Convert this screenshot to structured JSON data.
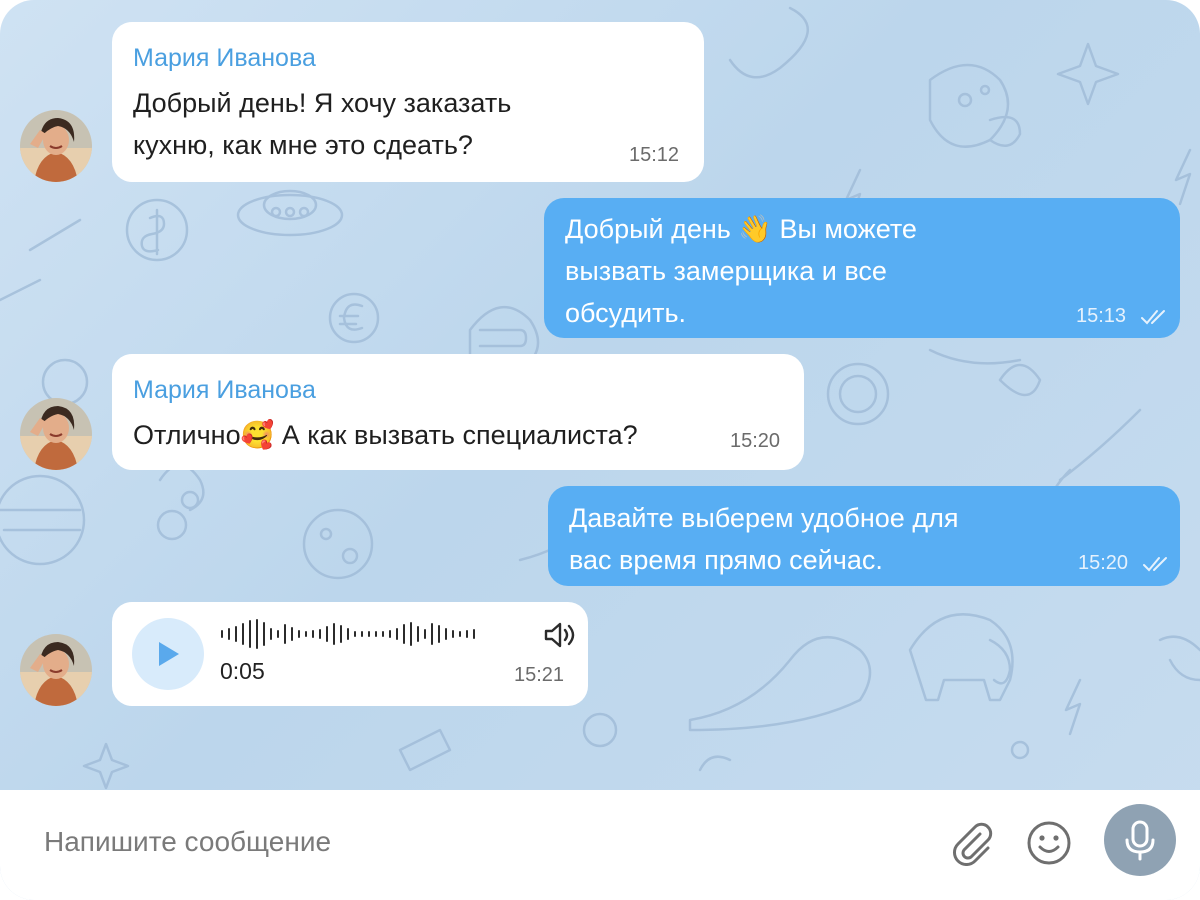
{
  "messages": [
    {
      "sender": "Мария Иванова",
      "text": "Добрый день! Я хочу заказать\nкухню, как мне это сдеать?",
      "time": "15:12"
    },
    {
      "text": "Добрый день 👋 Вы можете\nвызвать замерщика и все\nобсудить.",
      "time": "15:13",
      "status": "read-double-check"
    },
    {
      "sender": "Мария Иванова",
      "text": "Отлично🥰 А как вызвать специалиста?",
      "time": "15:20"
    },
    {
      "text": "Давайте выберем удобное для\nвас время прямо сейчас.",
      "time": "15:20",
      "status": "read-double-check"
    },
    {
      "voice": {
        "duration": "0:05",
        "time": "15:21",
        "icons": [
          "play-icon",
          "speaker-icon"
        ]
      }
    }
  ],
  "composer": {
    "placeholder": "Напишите сообщение",
    "icons": [
      "paperclip-icon",
      "smile-icon",
      "microphone-icon"
    ]
  },
  "colors": {
    "incoming_bubble": "#ffffff",
    "outgoing_bubble": "#58aef3",
    "sender_name": "#4a9fe0",
    "mic_button": "#8fa2b3",
    "background": "#c5dbef"
  }
}
